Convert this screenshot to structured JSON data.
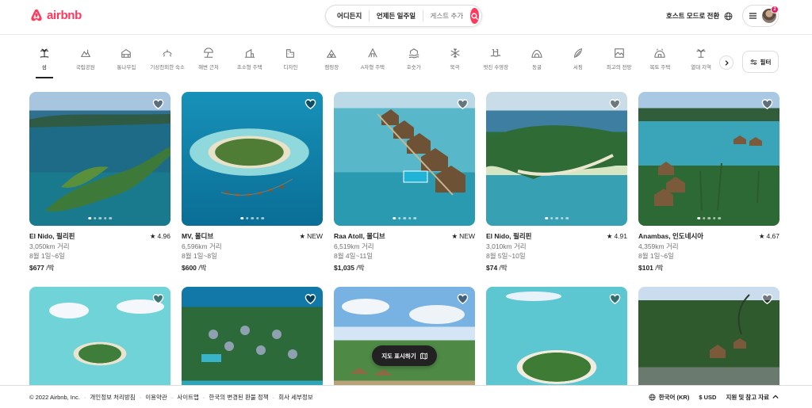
{
  "header": {
    "brand": "airbnb",
    "search": {
      "anywhere": "어디든지",
      "week": "언제든 일주일",
      "guests": "게스트 추가"
    },
    "host_link": "호스트 모드로 전환",
    "notifications": "2"
  },
  "categories": [
    {
      "label": "섬",
      "icon": "island-icon",
      "active": true
    },
    {
      "label": "국립공원",
      "icon": "national-park-icon"
    },
    {
      "label": "통나무집",
      "icon": "cabin-icon"
    },
    {
      "label": "기상천외한 숙소",
      "icon": "omg-icon"
    },
    {
      "label": "해변 근처",
      "icon": "beach-icon"
    },
    {
      "label": "초소형 주택",
      "icon": "tiny-home-icon"
    },
    {
      "label": "디자인",
      "icon": "design-icon"
    },
    {
      "label": "캠핑장",
      "icon": "camping-icon"
    },
    {
      "label": "A자형 주택",
      "icon": "a-frame-icon"
    },
    {
      "label": "호숫가",
      "icon": "lakefront-icon"
    },
    {
      "label": "북극",
      "icon": "arctic-icon"
    },
    {
      "label": "멋진 수영장",
      "icon": "pool-icon"
    },
    {
      "label": "동굴",
      "icon": "cave-icon"
    },
    {
      "label": "서핑",
      "icon": "surfing-icon"
    },
    {
      "label": "최고의 전망",
      "icon": "views-icon"
    },
    {
      "label": "복토 주택",
      "icon": "earth-home-icon"
    },
    {
      "label": "열대 지역",
      "icon": "tropical-icon"
    }
  ],
  "filter_label": "필터",
  "listings": [
    {
      "location": "El Nido, 필리핀",
      "rating": "4.96",
      "distance": "3,050km 거리",
      "dates": "8월 1일~6일",
      "price": "$677",
      "per": " /박"
    },
    {
      "location": "MV, 몰디브",
      "rating": "NEW",
      "distance": "6,596km 거리",
      "dates": "8월 1일~8일",
      "price": "$600",
      "per": " /박"
    },
    {
      "location": "Raa Atoll, 몰디브",
      "rating": "NEW",
      "distance": "6,519km 거리",
      "dates": "8월 4일~11일",
      "price": "$1,035",
      "per": " /박"
    },
    {
      "location": "El Nido, 필리핀",
      "rating": "4.91",
      "distance": "3,010km 거리",
      "dates": "8월 5일~10일",
      "price": "$74",
      "per": " /박"
    },
    {
      "location": "Anambas, 인도네시아",
      "rating": "4.67",
      "distance": "4,359km 거리",
      "dates": "8월 1일~6일",
      "price": "$101",
      "per": " /박"
    },
    {
      "location": "",
      "rating": "",
      "distance": "",
      "dates": "",
      "price": "",
      "per": ""
    },
    {
      "location": "",
      "rating": "",
      "distance": "",
      "dates": "",
      "price": "",
      "per": ""
    },
    {
      "location": "",
      "rating": "",
      "distance": "",
      "dates": "",
      "price": "",
      "per": ""
    },
    {
      "location": "",
      "rating": "",
      "distance": "",
      "dates": "",
      "price": "",
      "per": ""
    },
    {
      "location": "",
      "rating": "",
      "distance": "",
      "dates": "",
      "price": "",
      "per": ""
    }
  ],
  "map_button": "지도 표시하기",
  "footer": {
    "copyright": "© 2022 Airbnb, Inc.",
    "links": [
      "개인정보 처리방침",
      "이용약관",
      "사이트맵",
      "한국의 변경된 환불 정책",
      "회사 세부정보"
    ],
    "language": "한국어 (KR)",
    "currency": "$ USD",
    "support": "지원 및 참고 자료"
  },
  "colors": {
    "brand": "#ff385c",
    "text": "#222222",
    "muted": "#717171"
  }
}
